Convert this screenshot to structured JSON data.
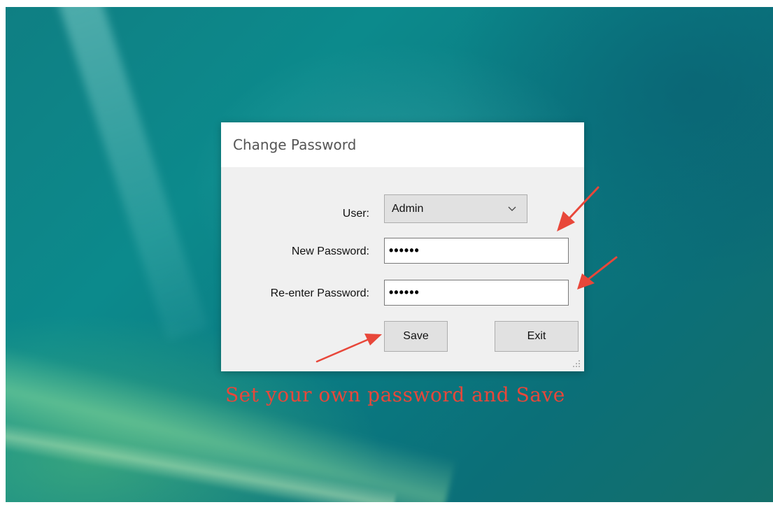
{
  "dialog": {
    "title": "Change Password",
    "user_label": "User:",
    "user_value": "Admin",
    "new_password_label": "New Password:",
    "new_password_value": "••••••",
    "reenter_password_label": "Re-enter Password:",
    "reenter_password_value": "••••••",
    "save_label": "Save",
    "exit_label": "Exit"
  },
  "annotation": {
    "caption": "Set your own password and Save",
    "arrow_color": "#e8473a"
  },
  "icons": {
    "dropdown": "chevron-down-icon",
    "resize": "resize-grip-icon",
    "arrow": "red-arrow-icon"
  }
}
